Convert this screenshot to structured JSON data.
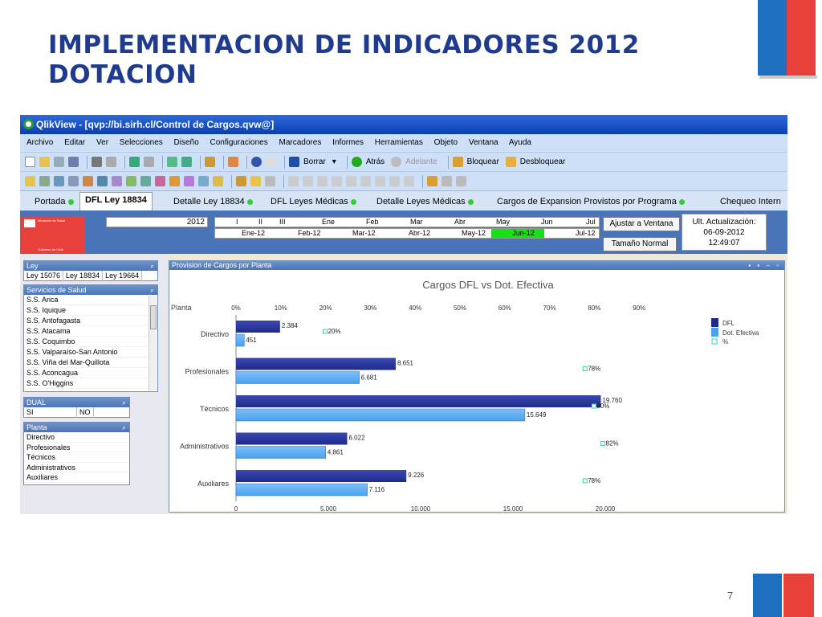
{
  "slide": {
    "title_line1": "IMPLEMENTACION DE INDICADORES 2012",
    "title_line2": "DOTACION",
    "page_number": "7"
  },
  "app": {
    "window_title": "QlikView - [qvp://bi.sirh.cl/Control de Cargos.qvw@]",
    "menu": [
      "Archivo",
      "Editar",
      "Ver",
      "Selecciones",
      "Diseño",
      "Configuraciones",
      "Marcadores",
      "Informes",
      "Herramientas",
      "Objeto",
      "Ventana",
      "Ayuda"
    ],
    "toolbar": {
      "borrar": "Borrar",
      "atras": "Atrás",
      "adelante": "Adelante",
      "bloquear": "Bloquear",
      "desbloquear": "Desbloquear"
    },
    "tabs": [
      {
        "label": "Portada"
      },
      {
        "label": "DFL Ley 18834"
      },
      {
        "label": "Detalle Ley 18834"
      },
      {
        "label": "DFL Leyes Médicas"
      },
      {
        "label": "Detalle Leyes Médicas"
      },
      {
        "label": "Cargos de Expansion Provistos por Programa"
      },
      {
        "label": "Chequeo Intern"
      }
    ],
    "active_tab": "DFL Ley 18834",
    "brand_text": "Ministerio de Salud",
    "brand_sub": "Gobierno de Chile",
    "year": "2012",
    "months_top": [
      "I",
      "II",
      "III",
      "Ene",
      "Feb",
      "Mar",
      "Abr",
      "May",
      "Jun",
      "Jul"
    ],
    "months_bottom": [
      "Ene-12",
      "Feb-12",
      "Mar-12",
      "Abr-12",
      "May-12",
      "Jun-12",
      "Jul-12"
    ],
    "selected_month": "Jun-12",
    "buttons": {
      "ajustar": "Ajustar a Ventana",
      "tamano": "Tamaño Normal"
    },
    "last_update": {
      "label": "Ult. Actualización:",
      "date": "06-09-2012",
      "time": "12:49:07"
    },
    "ley_box": {
      "header": "Ley",
      "items": [
        "Ley 15076",
        "Ley 18834",
        "Ley 19664"
      ]
    },
    "servicios_box": {
      "header": "Servicios de Salud",
      "items": [
        "S.S. Arica",
        "S.S. Iquique",
        "S.S. Antofagasta",
        "S.S. Atacama",
        "S.S. Coquimbo",
        "S.S. Valparaíso-San Antonio",
        "S.S. Viña del Mar-Quillota",
        "S.S. Aconcagua",
        "S.S. O'Higgins"
      ]
    },
    "dual_box": {
      "header": "DUAL",
      "items": [
        "SI",
        "NO"
      ]
    },
    "planta_box": {
      "header": "Planta",
      "items": [
        "Directivo",
        "Profesionales",
        "Técnicos",
        "Administrativos",
        "Auxiliares"
      ]
    },
    "chart_window_title": "Provision de Cargos por Planta",
    "colors": {
      "dfl": "#1f2a8c",
      "dot": "#4aa0ee",
      "pct": "#33d6a8"
    }
  },
  "chart_data": {
    "type": "bar",
    "title": "Cargos DFL vs Dot. Efectiva",
    "categories_label": "Planta",
    "categories": [
      "Directivo",
      "Profesionales",
      "Técnicos",
      "Administrativos",
      "Auxiliares"
    ],
    "series": [
      {
        "name": "DFL",
        "values": [
          2384,
          8651,
          19760,
          6022,
          9226
        ],
        "labels": [
          "2.384",
          "8.651",
          "19.760",
          "6.022",
          "9.226"
        ]
      },
      {
        "name": "Dot. Efectiva",
        "values": [
          451,
          6681,
          15649,
          4861,
          7116
        ],
        "labels": [
          "451",
          "6.681",
          "15.649",
          "4.861",
          "7.116"
        ]
      },
      {
        "name": "%",
        "values": [
          20,
          78,
          80,
          82,
          78
        ],
        "labels": [
          "20%",
          "78%",
          "80%",
          "82%",
          "78%"
        ]
      }
    ],
    "x_ticks": [
      "0",
      "5.000",
      "10.000",
      "15.000",
      "20.000"
    ],
    "x_values": [
      0,
      5000,
      10000,
      15000,
      20000
    ],
    "xlim": [
      0,
      20000
    ],
    "pct_ticks": [
      "0%",
      "10%",
      "20%",
      "30%",
      "40%",
      "50%",
      "60%",
      "70%",
      "80%",
      "90%"
    ],
    "pct_values": [
      0,
      10,
      20,
      30,
      40,
      50,
      60,
      70,
      80,
      90
    ],
    "legend": "right"
  }
}
